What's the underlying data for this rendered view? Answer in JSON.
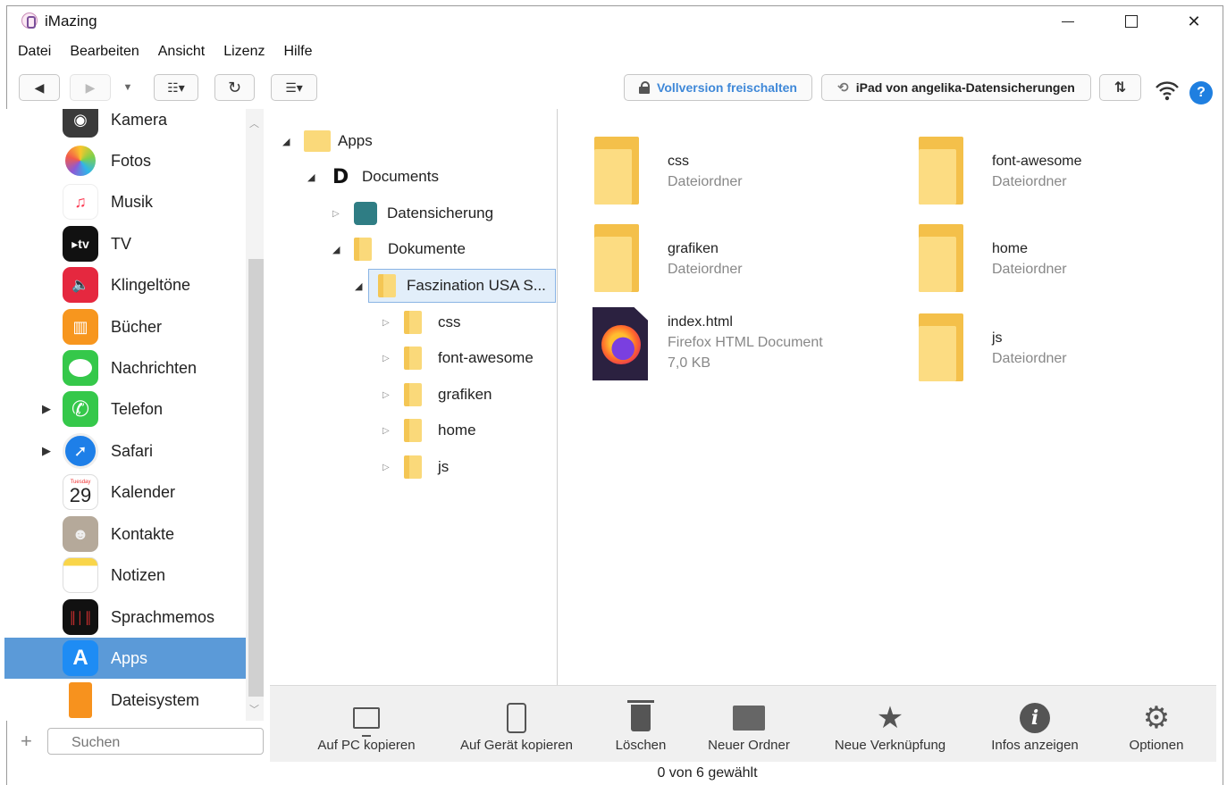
{
  "window": {
    "title": "iMazing"
  },
  "menu": [
    "Datei",
    "Bearbeiten",
    "Ansicht",
    "Lizenz",
    "Hilfe"
  ],
  "toolbar": {
    "unlock_label": "Vollversion freischalten",
    "backup_label": "iPad von angelika-Datensicherungen",
    "help_label": "?"
  },
  "sidebar": {
    "items": [
      {
        "label": "Kamera",
        "icon": "camera-icon",
        "color": "#3a3a3a"
      },
      {
        "label": "Fotos",
        "icon": "photos-icon",
        "color": "#ffffff"
      },
      {
        "label": "Musik",
        "icon": "music-icon",
        "color": "#fc3c54"
      },
      {
        "label": "TV",
        "icon": "tv-icon",
        "color": "#111111"
      },
      {
        "label": "Klingeltöne",
        "icon": "ringtones-icon",
        "color": "#e5283f"
      },
      {
        "label": "Bücher",
        "icon": "books-icon",
        "color": "#f7961e"
      },
      {
        "label": "Nachrichten",
        "icon": "messages-icon",
        "color": "#35c84a"
      },
      {
        "label": "Telefon",
        "icon": "phone-icon",
        "color": "#35c84a"
      },
      {
        "label": "Safari",
        "icon": "safari-icon",
        "color": "#1e7fe8"
      },
      {
        "label": "Kalender",
        "icon": "calendar-icon",
        "color": "#ffffff",
        "weekday": "Tuesday",
        "day": "29"
      },
      {
        "label": "Kontakte",
        "icon": "contacts-icon",
        "color": "#b5a99a"
      },
      {
        "label": "Notizen",
        "icon": "notes-icon",
        "color": "#ffffff"
      },
      {
        "label": "Sprachmemos",
        "icon": "voice-memos-icon",
        "color": "#111111"
      },
      {
        "label": "Apps",
        "icon": "app-store-icon",
        "color": "#1e8cf4"
      },
      {
        "label": "Dateisystem",
        "icon": "filesystem-icon",
        "color": "#f7921e"
      }
    ],
    "search_placeholder": "Suchen"
  },
  "tree": {
    "nodes": [
      {
        "label": "Apps",
        "level": 0,
        "state": "open"
      },
      {
        "label": "Documents",
        "level": 1,
        "state": "open"
      },
      {
        "label": "Datensicherung",
        "level": 2,
        "state": "closed"
      },
      {
        "label": "Dokumente",
        "level": 2,
        "state": "open"
      },
      {
        "label": "Faszination USA S...",
        "level": 3,
        "state": "open",
        "selected": true
      },
      {
        "label": "css",
        "level": 4,
        "state": "closed"
      },
      {
        "label": "font-awesome",
        "level": 4,
        "state": "closed"
      },
      {
        "label": "grafiken",
        "level": 4,
        "state": "closed"
      },
      {
        "label": "home",
        "level": 4,
        "state": "closed"
      },
      {
        "label": "js",
        "level": 4,
        "state": "closed"
      }
    ]
  },
  "files": [
    {
      "name": "css",
      "kind": "Dateiordner"
    },
    {
      "name": "font-awesome",
      "kind": "Dateiordner"
    },
    {
      "name": "grafiken",
      "kind": "Dateiordner"
    },
    {
      "name": "home",
      "kind": "Dateiordner"
    },
    {
      "name": "index.html",
      "kind": "Firefox HTML Document",
      "size": "7,0 KB"
    },
    {
      "name": "js",
      "kind": "Dateiordner"
    }
  ],
  "actions": [
    {
      "label": "Auf PC kopieren",
      "icon": "copy-to-pc-icon"
    },
    {
      "label": "Auf Gerät kopieren",
      "icon": "copy-to-device-icon"
    },
    {
      "label": "Löschen",
      "icon": "trash-icon"
    },
    {
      "label": "Neuer Ordner",
      "icon": "new-folder-icon"
    },
    {
      "label": "Neue Verknüpfung",
      "icon": "star-icon"
    },
    {
      "label": "Infos anzeigen",
      "icon": "info-icon"
    },
    {
      "label": "Optionen",
      "icon": "gear-icon"
    }
  ],
  "status": {
    "text": "0 von 6 gewählt"
  },
  "colors": {
    "accent": "#3f88d8",
    "selection": "#5b9ad8",
    "help": "#1f7fe0"
  }
}
